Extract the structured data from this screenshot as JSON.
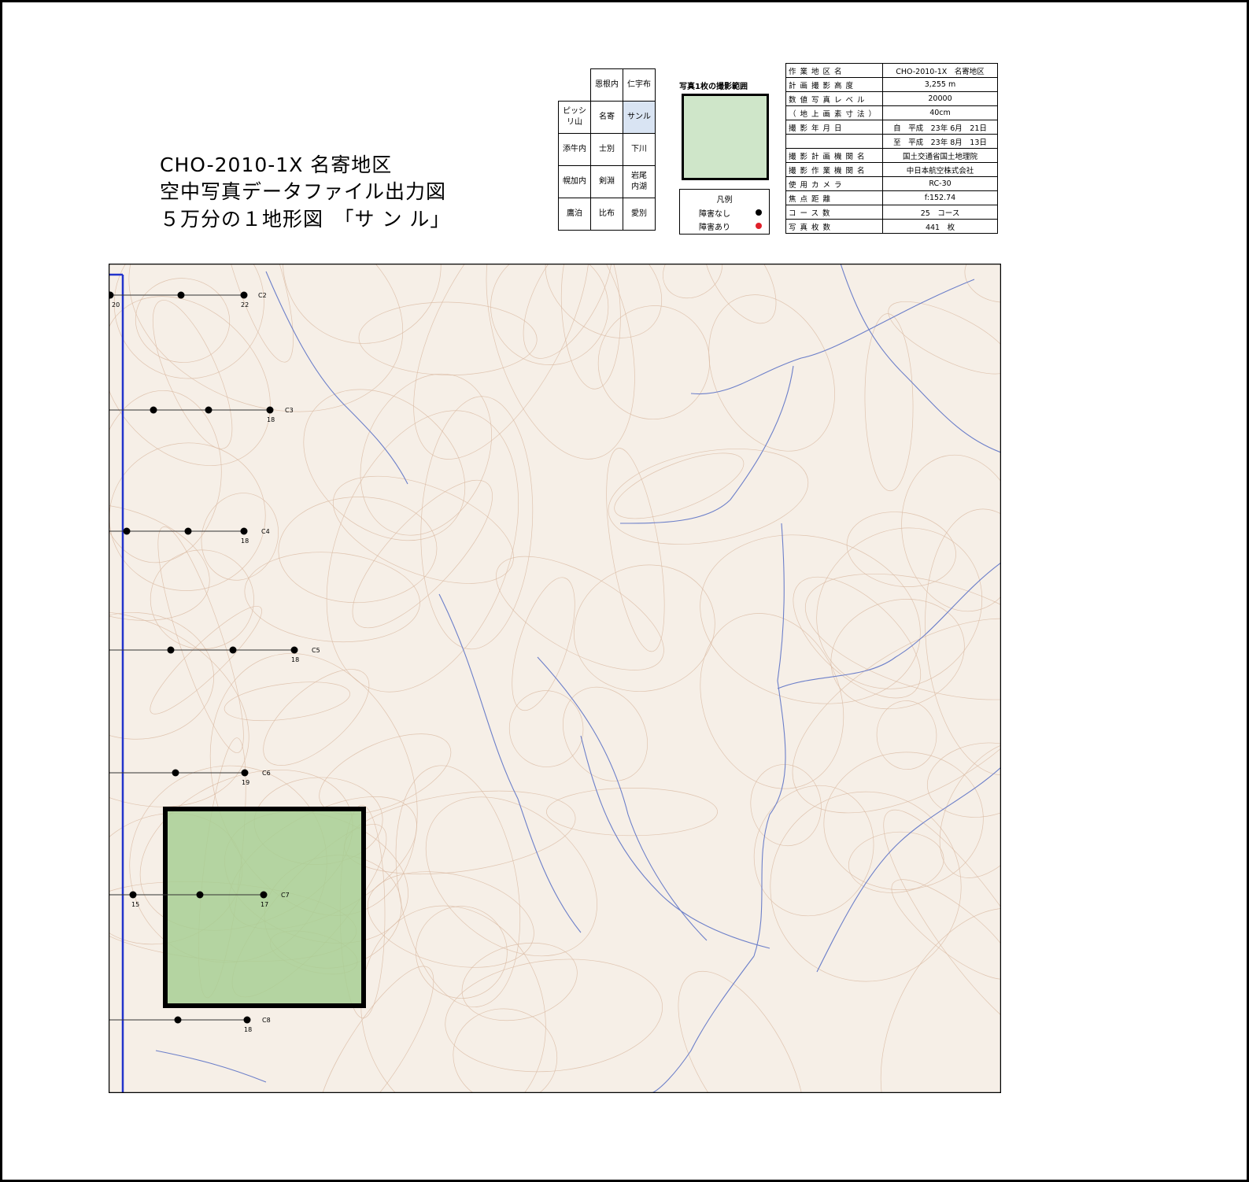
{
  "title": {
    "line1": "CHO-2010-1X 名寄地区",
    "line2": "空中写真データファイル出力図",
    "line3": "５万分の１地形図　「サ ン ル」"
  },
  "index_grid": {
    "rows": [
      [
        "",
        "恩根内",
        "仁宇布"
      ],
      [
        "ピッシ\nリ山",
        "名寄",
        "サンル"
      ],
      [
        "添牛内",
        "士別",
        "下川"
      ],
      [
        "幌加内",
        "剣淵",
        "岩尾\n内湖"
      ],
      [
        "鷹泊",
        "比布",
        "愛別"
      ]
    ],
    "highlighted": "サンル"
  },
  "coverage": {
    "title": "写真1枚の撮影範囲"
  },
  "legend": {
    "title": "凡例",
    "no_obstacle": "障害なし",
    "obstacle": "障害あり",
    "no_obstacle_color": "#000000",
    "obstacle_color": "#e0202a"
  },
  "info": [
    {
      "key": "作業地区名",
      "value": "CHO-2010-1X　名寄地区"
    },
    {
      "key": "計画撮影高度",
      "value": "3,255 m"
    },
    {
      "key": "数値写真レベル",
      "value": "20000"
    },
    {
      "key": "（地上画素寸法）",
      "value": "40cm"
    },
    {
      "key": "撮影年月日",
      "value": "自　平成　23年 6月　21日"
    },
    {
      "key": "",
      "value": "至　平成　23年 8月　13日"
    },
    {
      "key": "撮影計画機関名",
      "value": "国土交通省国土地理院"
    },
    {
      "key": "撮影作業機関名",
      "value": "中日本航空株式会社"
    },
    {
      "key": "使用カメラ",
      "value": "RC-30"
    },
    {
      "key": "焦点距離",
      "value": "f:152.74"
    },
    {
      "key": "コース数",
      "value": "25　コース"
    },
    {
      "key": "写真枚数",
      "value": "441　枚"
    }
  ],
  "map": {
    "colors": {
      "background": "#f6efe7",
      "contour": "#d9b9a1",
      "river": "#6c7fc9",
      "boundary": "#2233cc",
      "highlight": "#a8cf94"
    },
    "courses": [
      {
        "name": "C2",
        "count": "22",
        "start_label": "20"
      },
      {
        "name": "C3",
        "count": "18"
      },
      {
        "name": "C4",
        "count": "18"
      },
      {
        "name": "C5",
        "count": "18"
      },
      {
        "name": "C6",
        "count": "19"
      },
      {
        "name": "C7",
        "count": "17",
        "start_label": "15"
      },
      {
        "name": "C8",
        "count": "18"
      }
    ]
  }
}
